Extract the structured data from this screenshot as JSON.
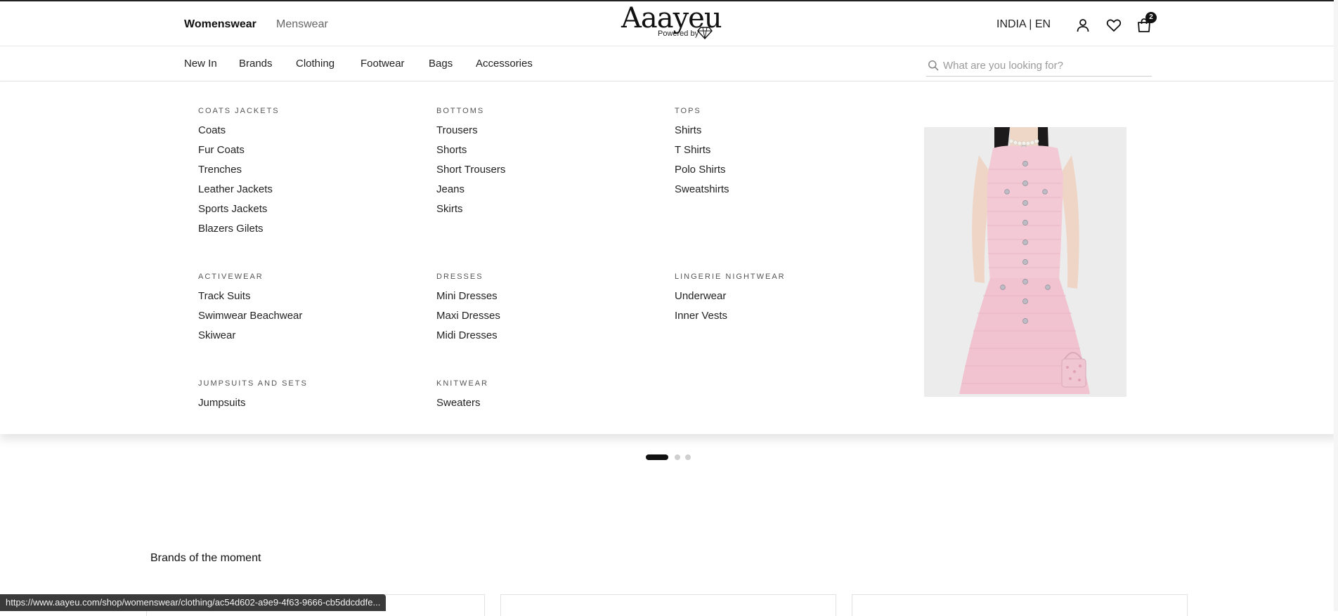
{
  "header": {
    "genders": [
      "Womenswear",
      "Menswear"
    ],
    "logo": {
      "wordmark": "Aaayeu",
      "powered_by": "Powered by"
    },
    "region": "INDIA | EN",
    "cart_count": "2"
  },
  "nav": {
    "items": [
      "New In",
      "Brands",
      "Clothing",
      "Footwear",
      "Bags",
      "Accessories"
    ],
    "search_placeholder": "What are you looking for?"
  },
  "menu": {
    "groups": [
      {
        "title": "COATS JACKETS",
        "items": [
          "Coats",
          "Fur Coats",
          "Trenches",
          "Leather Jackets",
          "Sports Jackets",
          "Blazers Gilets"
        ]
      },
      {
        "title": "BOTTOMS",
        "items": [
          "Trousers",
          "Shorts",
          "Short Trousers",
          "Jeans",
          "Skirts"
        ]
      },
      {
        "title": "TOPS",
        "items": [
          "Shirts",
          "T Shirts",
          "Polo Shirts",
          "Sweatshirts"
        ]
      },
      {
        "title": "ACTIVEWEAR",
        "items": [
          "Track Suits",
          "Swimwear Beachwear",
          "Skiwear"
        ]
      },
      {
        "title": "DRESSES",
        "items": [
          "Mini Dresses",
          "Maxi Dresses",
          "Midi Dresses"
        ]
      },
      {
        "title": "LINGERIE NIGHTWEAR",
        "items": [
          "Underwear",
          "Inner Vests"
        ]
      },
      {
        "title": "JUMPSUITS AND SETS",
        "items": [
          "Jumpsuits"
        ]
      },
      {
        "title": "KNITWEAR",
        "items": [
          "Sweaters"
        ]
      }
    ]
  },
  "carousel": {
    "total": 3,
    "active": 1
  },
  "brands_section": {
    "title": "Brands of the moment"
  },
  "status_bar": {
    "url": "https://www.aayeu.com/shop/womenswear/clothing/ac54d602-a9e9-4f63-9666-cb5ddcddfe..."
  },
  "colors": {
    "accent": "#111111",
    "promo_dress": "#f3c9d6"
  }
}
